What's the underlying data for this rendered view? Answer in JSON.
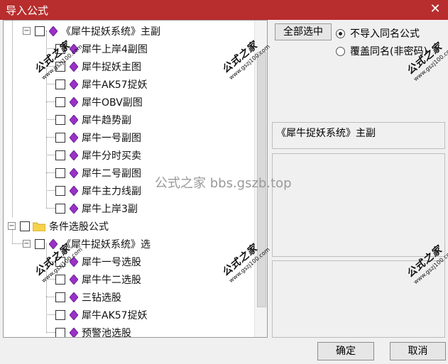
{
  "window": {
    "title": "导入公式",
    "close_glyph": "✕"
  },
  "tree": {
    "group1_label": "《犀牛捉妖系统》主副",
    "group1_items": [
      "犀牛上岸4副图",
      "犀牛捉妖主图",
      "犀牛AK57捉妖",
      "犀牛OBV副图",
      "犀牛趋势副",
      "犀牛一号副图",
      "犀牛分时买卖",
      "犀牛二号副图",
      "犀牛主力线副",
      "犀牛上岸3副"
    ],
    "category2_label": "条件选股公式",
    "group2_label": "《犀牛捉妖系统》选",
    "group2_items": [
      "犀牛一号选股",
      "犀牛牛二选股",
      "三钻选股",
      "犀牛AK57捉妖",
      "预警池选股"
    ]
  },
  "options": {
    "select_all_label": "全部选中",
    "radio_skip_label": "不导入同名公式",
    "radio_overwrite_label": "覆盖同名(非密码)",
    "radio_selected": "skip"
  },
  "info": {
    "selected_name": "《犀牛捉妖系统》主副"
  },
  "buttons": {
    "ok_label": "确定",
    "cancel_label": "取消"
  },
  "watermark": {
    "main_text": "公式之家",
    "url_text": "www.gszj100.com",
    "center_text": "公式之家 bbs.gszb.top"
  },
  "colors": {
    "titlebar": "#b82d2d",
    "gem": "#9b30c8",
    "folder": "#f5d24a"
  }
}
